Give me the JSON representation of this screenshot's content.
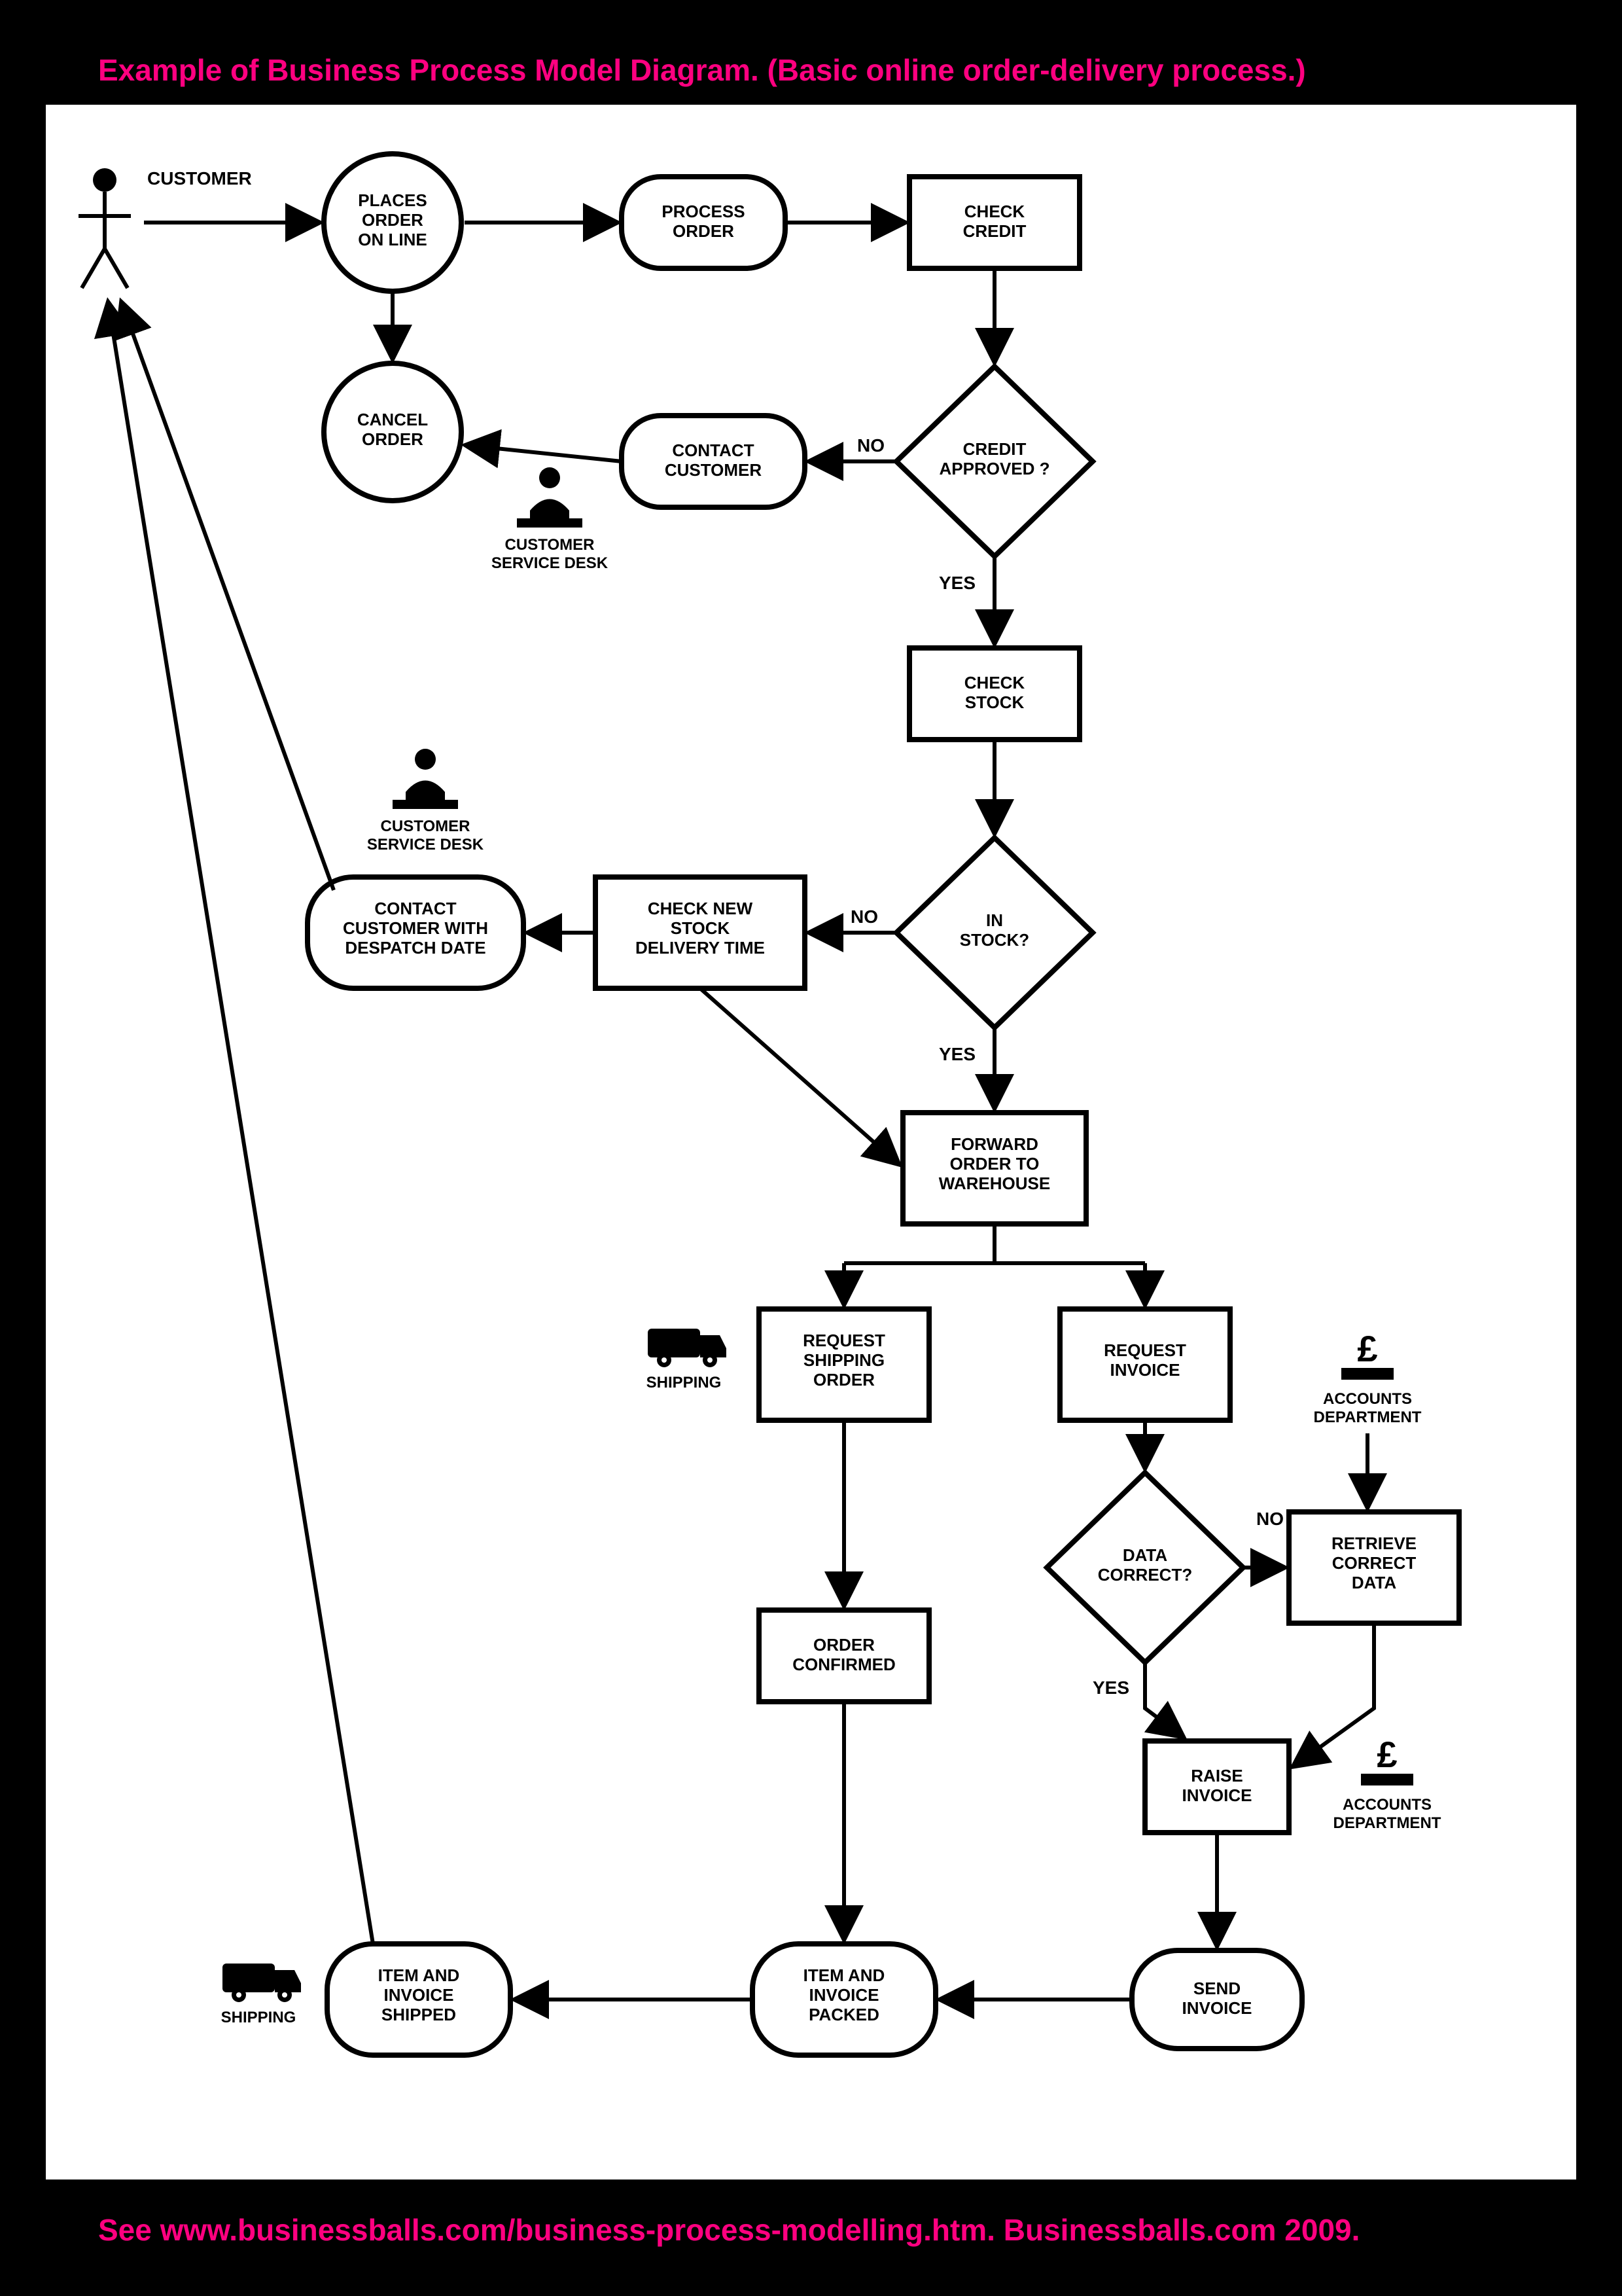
{
  "title": "Example of Business Process Model Diagram. (Basic online order-delivery process.)",
  "footer": "See www.businessballs.com/business-process-modelling.htm.  Businessballs.com 2009.",
  "labels": {
    "customer": "CUSTOMER",
    "csd1": "CUSTOMER\nSERVICE DESK",
    "csd2": "CUSTOMER\nSERVICE DESK",
    "shipping1": "SHIPPING",
    "shipping2": "SHIPPING",
    "accounts1": "ACCOUNTS\nDEPARTMENT",
    "accounts2": "ACCOUNTS\nDEPARTMENT",
    "yes": "YES",
    "no": "NO"
  },
  "nodes": {
    "places_order": "PLACES\nORDER\nON LINE",
    "process_order": "PROCESS\nORDER",
    "check_credit": "CHECK\nCREDIT",
    "cancel_order": "CANCEL\nORDER",
    "contact_customer": "CONTACT\nCUSTOMER",
    "credit_approved": "CREDIT\nAPPROVED ?",
    "check_stock": "CHECK\nSTOCK",
    "in_stock": "IN\nSTOCK?",
    "check_new_stock": "CHECK NEW\nSTOCK\nDELIVERY TIME",
    "contact_despatch": "CONTACT\nCUSTOMER WITH\nDESPATCH DATE",
    "forward_warehouse": "FORWARD\nORDER TO\nWAREHOUSE",
    "request_shipping": "REQUEST\nSHIPPING\nORDER",
    "request_invoice": "REQUEST\nINVOICE",
    "data_correct": "DATA\nCORRECT?",
    "retrieve_data": "RETRIEVE\nCORRECT\nDATA",
    "order_confirmed": "ORDER\nCONFIRMED",
    "raise_invoice": "RAISE\nINVOICE",
    "send_invoice": "SEND\nINVOICE",
    "item_packed": "ITEM AND\nINVOICE\nPACKED",
    "item_shipped": "ITEM AND\nINVOICE\nSHIPPED"
  }
}
